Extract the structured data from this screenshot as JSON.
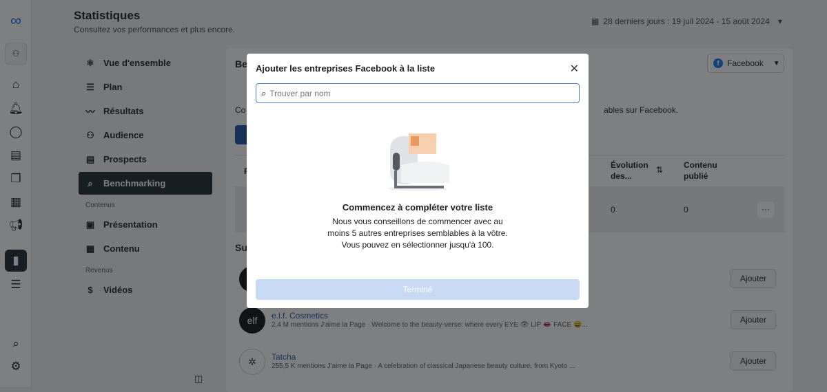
{
  "header": {
    "title": "Statistiques",
    "subtitle": "Consultez vos performances et plus encore.",
    "date_range": "28 derniers jours : 19 juil 2024 - 15 août 2024"
  },
  "nav": {
    "items": [
      {
        "label": "Vue d'ensemble",
        "icon": "network"
      },
      {
        "label": "Plan",
        "icon": "list"
      },
      {
        "label": "Résultats",
        "icon": "trend"
      },
      {
        "label": "Audience",
        "icon": "people"
      },
      {
        "label": "Prospects",
        "icon": "id-card"
      },
      {
        "label": "Benchmarking",
        "icon": "benchmark",
        "active": true
      }
    ],
    "section_contenus": "Contenus",
    "contenus": [
      {
        "label": "Présentation",
        "icon": "gallery"
      },
      {
        "label": "Contenu",
        "icon": "table"
      }
    ],
    "section_revenus": "Revenus",
    "revenus": [
      {
        "label": "Vidéos",
        "icon": "dollar"
      }
    ]
  },
  "main": {
    "title_partial": "Be",
    "platform": "Facebook",
    "desc_partial": "Co",
    "desc_end": "ables sur Facebook.",
    "suggestions_partial": "Su",
    "table": {
      "col_partial": "P",
      "col_evolution": "Évolution des...",
      "col_content": "Contenu publié",
      "row": {
        "evolution": "0",
        "content": "0"
      }
    },
    "suggestions": [
      {
        "name": "",
        "meta": "",
        "avatar": "c"
      },
      {
        "name": "e.l.f. Cosmetics",
        "meta": "2,4 M mentions J'aime la Page · Welcome to the beauty-verse: where every EYE 👁 LIP 👄 FACE 😄...",
        "avatar": "elf"
      },
      {
        "name": "Tatcha",
        "meta": "255,5 K mentions J'aime la Page · A celebration of classical Japanese beauty culture, from Kyoto ...",
        "avatar": "✲"
      }
    ],
    "add_label": "Ajouter"
  },
  "modal": {
    "title": "Ajouter les entreprises Facebook à la liste",
    "search_placeholder": "Trouver par nom",
    "empty_title": "Commencez à compléter votre liste",
    "empty_text": [
      "Nous vous conseillons de commencer avec au",
      "moins 5 autres entreprises semblables à la vôtre.",
      "Vous pouvez en sélectionner jusqu'à 100."
    ],
    "done_label": "Terminé"
  },
  "colors": {
    "accent": "#1877f2",
    "active_nav": "#1c2b33",
    "done_disabled": "#c8daf3"
  }
}
